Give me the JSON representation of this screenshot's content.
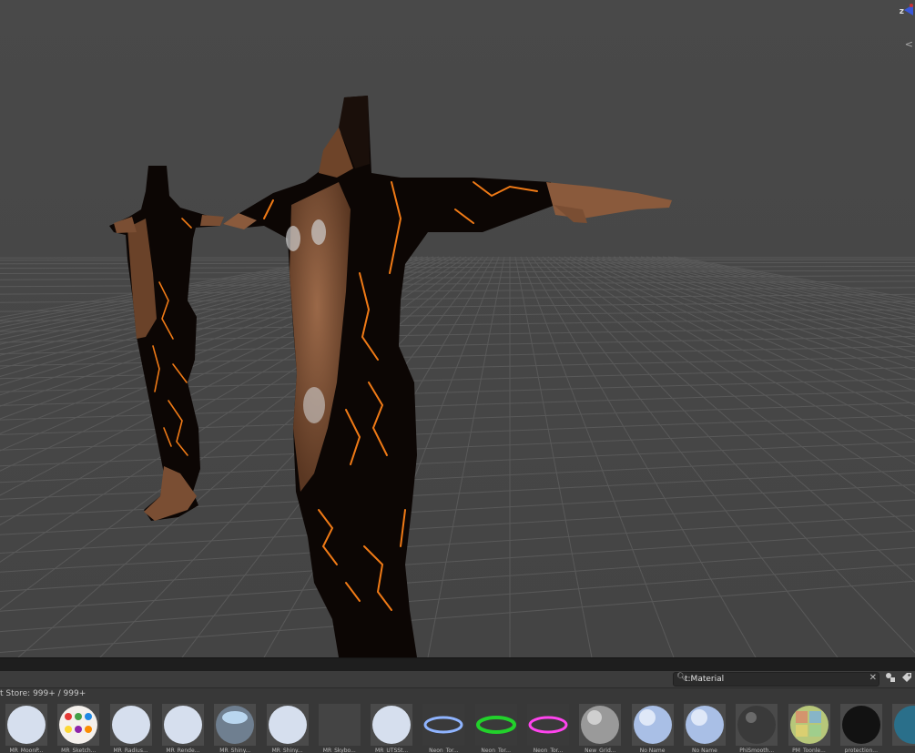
{
  "viewport": {
    "gizmo_axis_label": "z",
    "gizmo_persp_glyph": "<",
    "colors": {
      "background": "#464646",
      "grid": "#5a5a5a",
      "skin": "#8a5a3c",
      "skin_dark": "#5a3722",
      "suit": "#0c0604",
      "lava": "#f07a16"
    }
  },
  "project_panel": {
    "store_label": "t Store: 999+ / 999+",
    "search": {
      "value": "t:Material",
      "icon": "search-icon"
    },
    "toolbar_icons": [
      "filter-by-type-icon",
      "filter-by-label-icon"
    ],
    "assets": [
      {
        "label": "MR_MoonP...",
        "kind": "plain-sphere"
      },
      {
        "label": "MR_Sketch...",
        "kind": "star-sphere"
      },
      {
        "label": "MR_Radius...",
        "kind": "plain-sphere"
      },
      {
        "label": "MR_Rende...",
        "kind": "plain-sphere"
      },
      {
        "label": "MR_Shiny...",
        "kind": "glass-sphere"
      },
      {
        "label": "MR_Shiny...",
        "kind": "plain-sphere"
      },
      {
        "label": "MR_Skybo...",
        "kind": "empty"
      },
      {
        "label": "MR_UTSSt...",
        "kind": "plain-sphere"
      },
      {
        "label": "Neon_Tor...",
        "kind": "ring-blue"
      },
      {
        "label": "Neon_Tor...",
        "kind": "ring-green"
      },
      {
        "label": "Neon_Tor...",
        "kind": "ring-pink"
      },
      {
        "label": "New_Grid...",
        "kind": "grey-sphere"
      },
      {
        "label": "No Name",
        "kind": "blue-sphere"
      },
      {
        "label": "No Name",
        "kind": "blue-sphere"
      },
      {
        "label": "PhiSmooth...",
        "kind": "dark-sphere"
      },
      {
        "label": "PM_Toonle...",
        "kind": "patch-sphere"
      },
      {
        "label": "protection...",
        "kind": "black-sphere"
      },
      {
        "label": "",
        "kind": "teal-sphere"
      }
    ]
  }
}
